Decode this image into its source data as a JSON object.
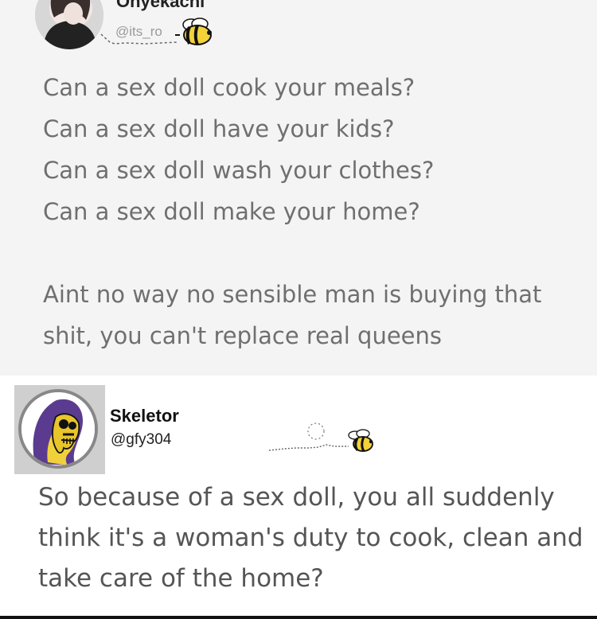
{
  "tweets": [
    {
      "display_name": "Onyekachi",
      "handle": "@its_ro",
      "text": "Can a sex doll cook your meals?\nCan a sex doll have your kids?\nCan a sex doll wash your clothes?\nCan a sex doll make your home?\n\nAint no way no sensible man is buying that shit, you can't replace real queens"
    },
    {
      "display_name": "Skeletor",
      "handle": "@gfy304",
      "text": "So because of a sex doll, you all suddenly think it's a woman's duty to cook, clean and take care of the home?"
    }
  ],
  "colors": {
    "tweet_one_background": "#f4f4f4",
    "tweet_two_background": "#ffffff",
    "tweet_one_text": "#6f6f6f",
    "tweet_two_text": "#555555",
    "bee_yellow": "#f3d23a",
    "skeletor_purple": "#5b3b8f"
  },
  "icons": {
    "bee": "bee-icon",
    "avatar_one": "avatar",
    "avatar_two": "skeletor-avatar"
  }
}
